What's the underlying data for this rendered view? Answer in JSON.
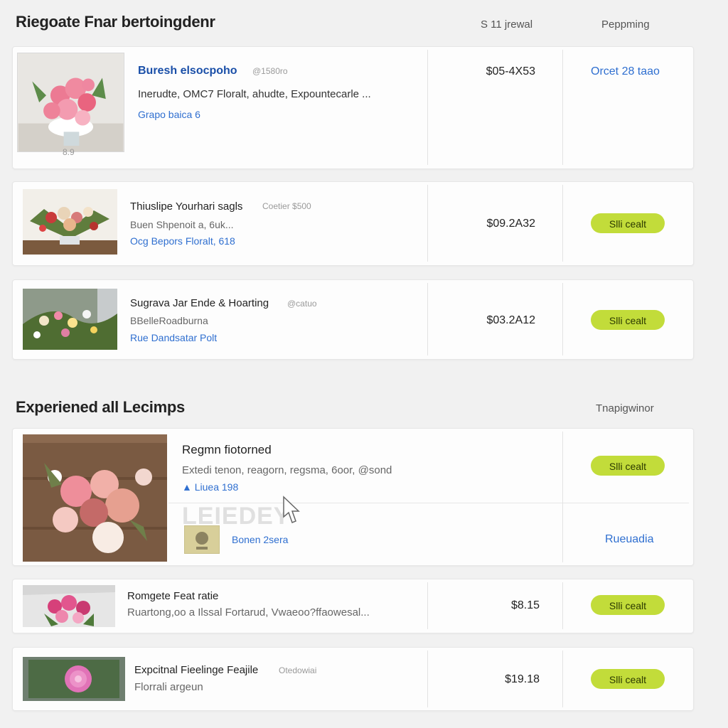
{
  "section1": {
    "title": "Riegoate Fnar bertoingdenr",
    "col_price": "S 11 jrewal",
    "col_action": "Peppming"
  },
  "section2": {
    "title": "Experiened all Lecimps",
    "col_action": "Tnapigwinor"
  },
  "items": [
    {
      "title": "Buresh elsocpoho",
      "tag": "@1580ro",
      "line1": "Inerudte, OMC7 Floralt, ahudte, Expountecarle ...",
      "link": "Grapo baica 6",
      "price": "$05-4X53",
      "action": "Orcet 28 taao",
      "thumb_caption": "8.9"
    },
    {
      "title": "Thiuslipe Yourhari sagls",
      "tag": "Coetier $500",
      "line1": "Buen Shpenoit a, 6uk...",
      "link": "Ocg Bepors Floralt, 618",
      "price": "$09.2A32",
      "action": "Slli cealt"
    },
    {
      "title": "Sugrava Jar Ende & Hoarting",
      "tag": "@catuo",
      "line1": "BBelleRoadburna",
      "link": "Rue Dandsatar Polt",
      "price": "$03.2A12",
      "action": "Slli cealt"
    },
    {
      "title": "Regmn fiotorned",
      "line1": "Extedi tenon, reagorn, regsma, 6oor, @sond",
      "link": "Liuea 198",
      "sub_link": "Bonen 2sera",
      "action": "Slli cealt",
      "side_link": "Rueuadia",
      "watermark": "LEIEDEY"
    },
    {
      "title": "Romgete Feat ratie",
      "line1": "Ruartong,oo a Ilssal Fortarud, Vwaeoo?ffaowesal...",
      "price": "$8.15",
      "action": "Slli cealt"
    },
    {
      "title": "Expcitnal Fieelinge Feajile",
      "tag": "Otedowiai",
      "line1": "Florrali argeun",
      "price": "$19.18",
      "action": "Slli cealt"
    }
  ],
  "colors": {
    "accent_button": "#c2dc3a",
    "link": "#2f6fd0",
    "title_link": "#1a4fa8"
  }
}
